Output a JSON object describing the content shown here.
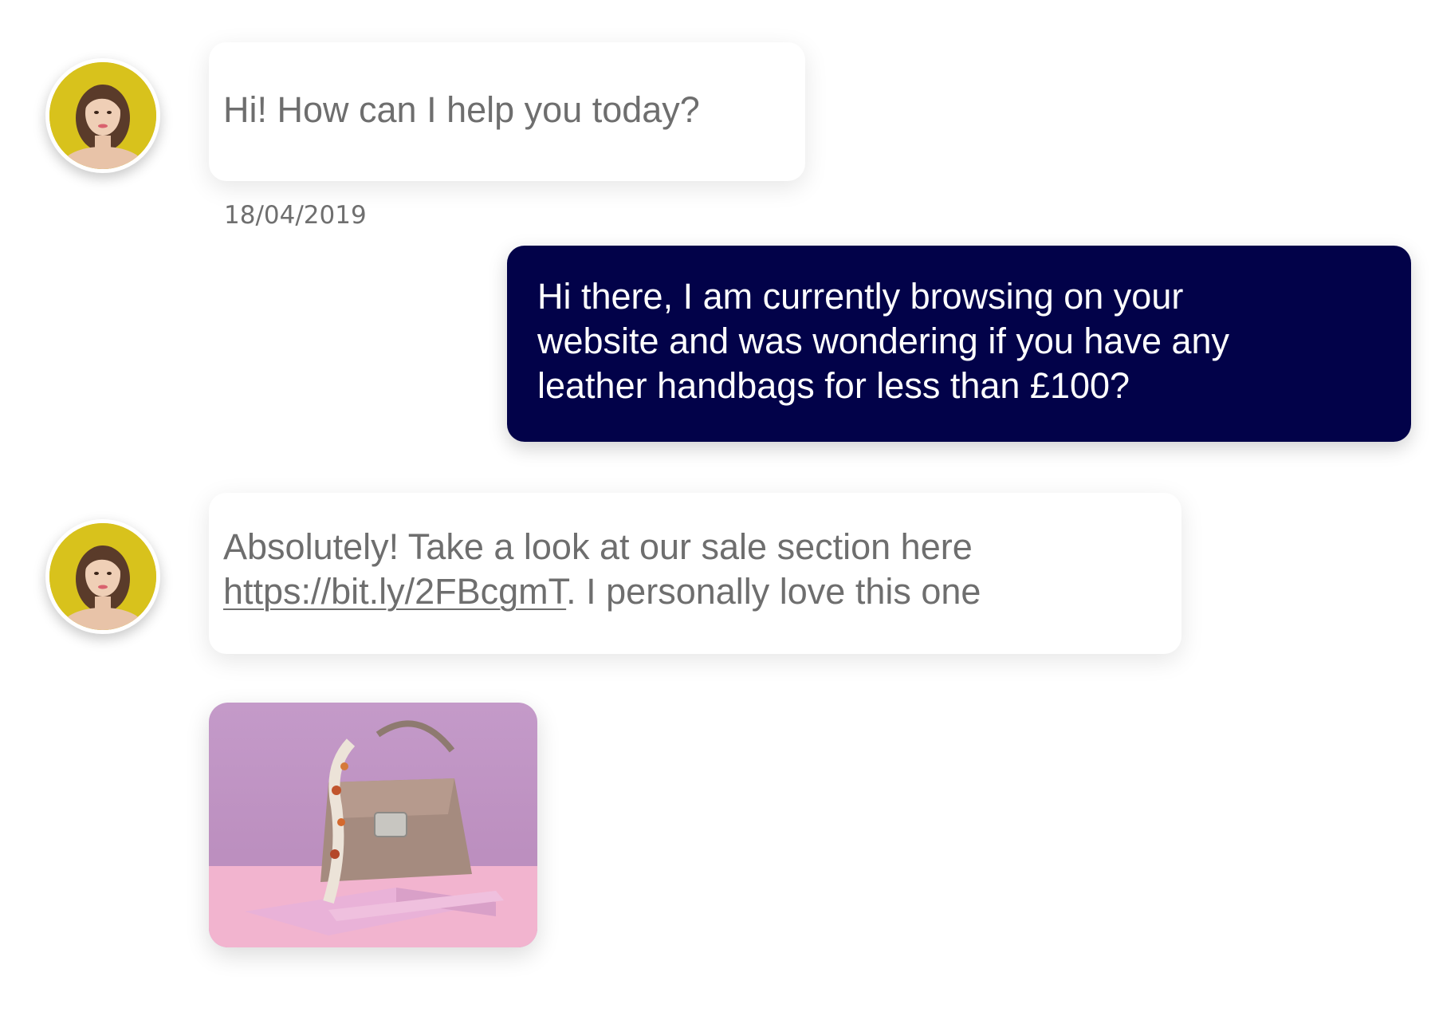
{
  "conversation": {
    "messages": [
      {
        "sender": "agent",
        "avatar_icon": "agent-avatar-icon",
        "text": "Hi! How can I help you today?",
        "timestamp": "18/04/2019"
      },
      {
        "sender": "user",
        "lines": [
          "Hi there, I am currently browsing on your",
          "website and was wondering if you have any",
          "leather handbags for less than £100?"
        ]
      },
      {
        "sender": "agent",
        "avatar_icon": "agent-avatar-icon",
        "line1": "Absolutely! Take a look at our sale section here",
        "link": "https://bit.ly/2FBcgmT",
        "line2_suffix": ". I personally love this one"
      },
      {
        "sender": "agent",
        "attachment": "handbag-photo",
        "colors": {
          "background_top": "#c49ac9",
          "floor": "#f2b4cf",
          "bag": "#a58b7f"
        }
      }
    ]
  },
  "colors": {
    "user_bubble": "#020249",
    "agent_text": "#6e6e6e",
    "avatar_background": "#d8c21c"
  }
}
